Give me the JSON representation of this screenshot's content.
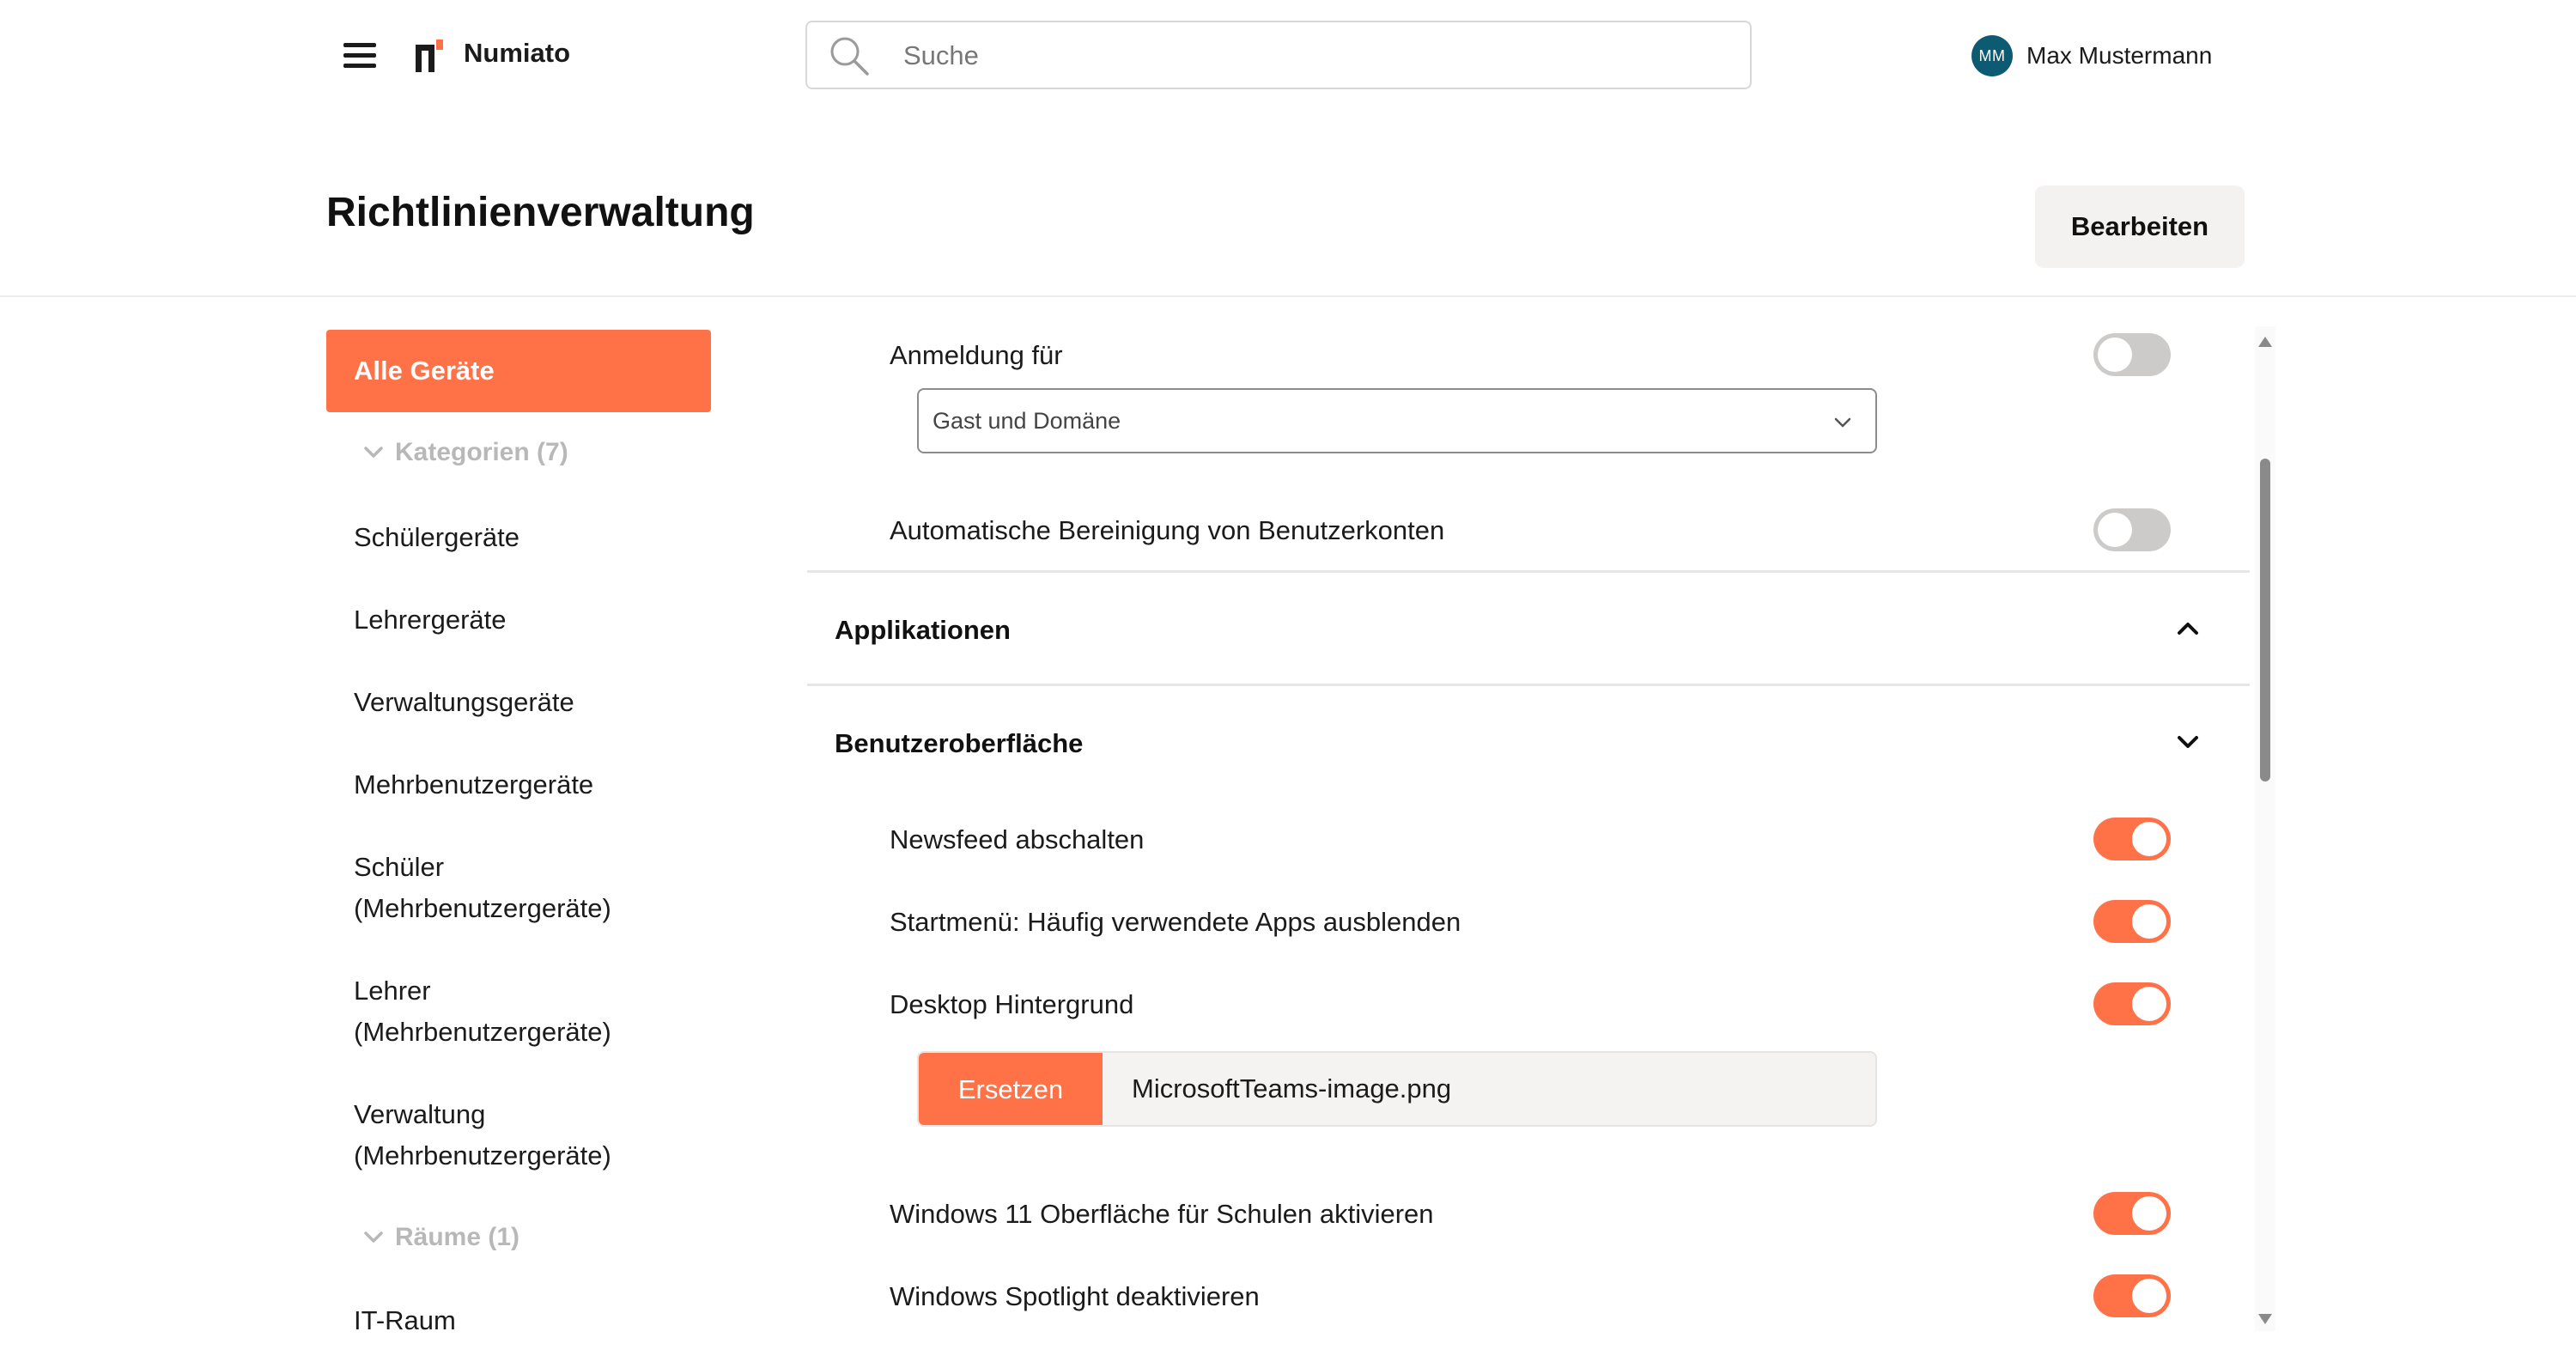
{
  "topbar": {
    "brand": "Numiato",
    "search_placeholder": "Suche",
    "user": {
      "initials": "MM",
      "name": "Max Mustermann"
    }
  },
  "page": {
    "title": "Richtlinienverwaltung",
    "edit_label": "Bearbeiten"
  },
  "sidebar": {
    "active_label": "Alle Geräte",
    "groups": [
      {
        "label": "Kategorien (7)",
        "items": [
          {
            "line1": "Schülergeräte",
            "line2": ""
          },
          {
            "line1": "Lehrergeräte",
            "line2": ""
          },
          {
            "line1": "Verwaltungsgeräte",
            "line2": ""
          },
          {
            "line1": "Mehrbenutzergeräte",
            "line2": ""
          },
          {
            "line1": "Schüler",
            "line2": "(Mehrbenutzergeräte)"
          },
          {
            "line1": "Lehrer",
            "line2": "(Mehrbenutzergeräte)"
          },
          {
            "line1": "Verwaltung",
            "line2": "(Mehrbenutzergeräte)"
          }
        ]
      },
      {
        "label": "Räume (1)",
        "items": [
          {
            "line1": "IT-Raum",
            "line2": ""
          }
        ]
      }
    ]
  },
  "main": {
    "login": {
      "label": "Anmeldung für",
      "enabled": false,
      "select_value": "Gast und Domäne"
    },
    "cleanup": {
      "label": "Automatische Bereinigung von Benutzerkonten",
      "enabled": false
    },
    "sections": [
      {
        "title": "Applikationen",
        "expanded": false
      },
      {
        "title": "Benutzeroberfläche",
        "expanded": true
      }
    ],
    "ui_settings": [
      {
        "label": "Newsfeed abschalten",
        "enabled": true
      },
      {
        "label": "Startmenü: Häufig verwendete Apps ausblenden",
        "enabled": true
      },
      {
        "label": "Desktop Hintergrund",
        "enabled": true
      },
      {
        "label": "Windows 11 Oberfläche für Schulen aktivieren",
        "enabled": true
      },
      {
        "label": "Windows Spotlight deaktivieren",
        "enabled": true
      }
    ],
    "file": {
      "button_label": "Ersetzen",
      "file_name": "MicrosoftTeams-image.png"
    }
  },
  "colors": {
    "accent": "#ff7247",
    "toggle_off": "#cdcbc9",
    "avatar": "#0d5a73",
    "muted_text": "#b8b8b8"
  },
  "icons": [
    "menu-icon",
    "numiato-logo",
    "search-icon",
    "chevron-down-icon",
    "chevron-up-icon",
    "scroll-up-arrow",
    "scroll-down-arrow"
  ]
}
